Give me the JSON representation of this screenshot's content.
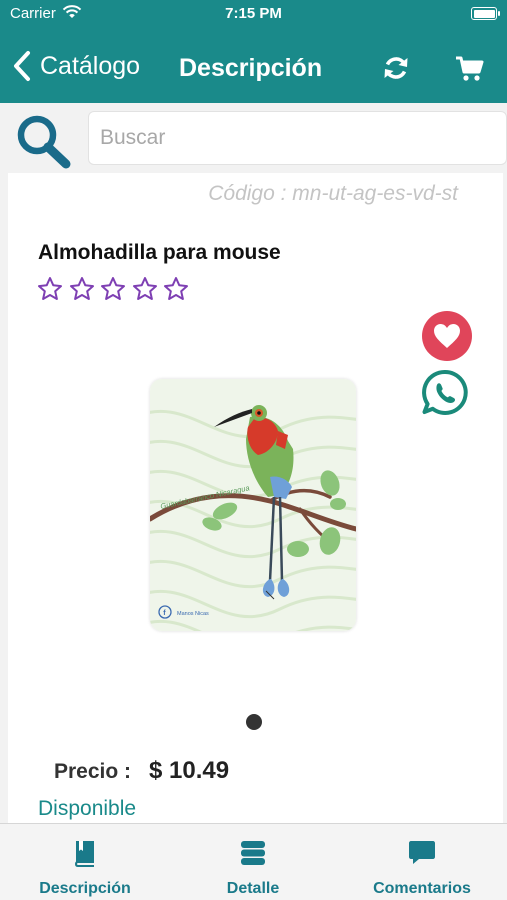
{
  "status_bar": {
    "carrier": "Carrier",
    "time": "7:15 PM"
  },
  "nav": {
    "back_label": "Catálogo",
    "title": "Descripción"
  },
  "search": {
    "placeholder": "Buscar",
    "value": ""
  },
  "product": {
    "code": "Código : mn-ut-ag-es-vd-st",
    "title": "Almohadilla para mouse",
    "rating": 0,
    "rating_max": 5,
    "image_page": 1,
    "image_pages": 1,
    "image_texts": {
      "caption": "Guardabarranco Nicaragua",
      "footer": "Manos Nicas"
    },
    "price_label": "Precio :",
    "price": "$ 10.49",
    "availability": "Disponible"
  },
  "tabs": [
    {
      "label": "Descripción",
      "icon": "book-icon"
    },
    {
      "label": "Detalle",
      "icon": "stack-icon"
    },
    {
      "label": "Comentarios",
      "icon": "chat-icon"
    }
  ],
  "colors": {
    "primary": "#1a8a8a",
    "favorite": "#e0455a",
    "whatsapp": "#1a8a7a",
    "star": "#7e3fb3",
    "tab": "#1a7a8a"
  }
}
